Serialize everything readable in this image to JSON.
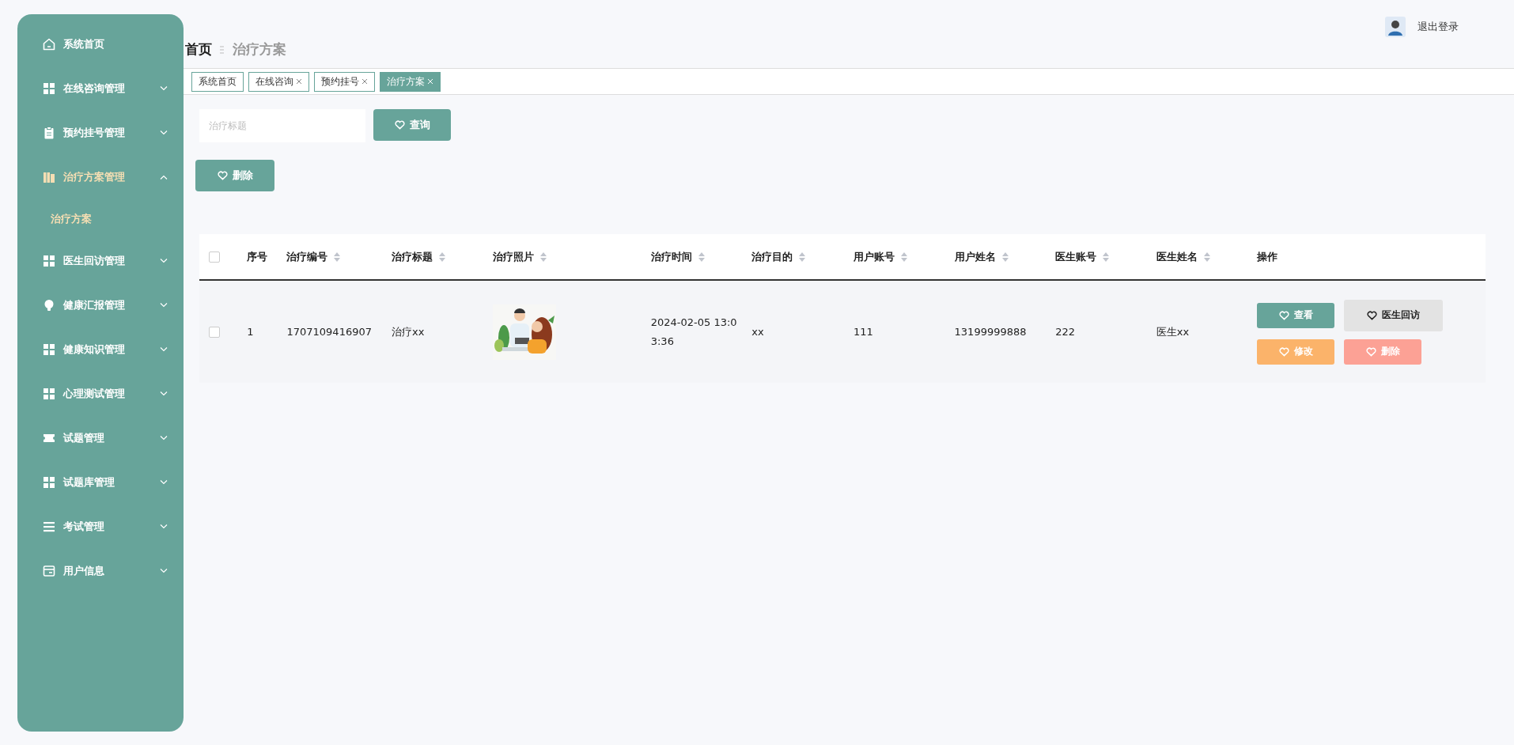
{
  "sidebar": {
    "items": [
      {
        "label": "系统首页",
        "kind": "home"
      },
      {
        "label": "在线咨询管理",
        "kind": "grid",
        "expandable": true,
        "expanded": false
      },
      {
        "label": "预约挂号管理",
        "kind": "clipboard",
        "expandable": true,
        "expanded": false
      },
      {
        "label": "治疗方案管理",
        "kind": "books",
        "expandable": true,
        "expanded": true,
        "children": [
          {
            "label": "治疗方案",
            "selected": true
          }
        ]
      },
      {
        "label": "医生回访管理",
        "kind": "grid",
        "expandable": true,
        "expanded": false
      },
      {
        "label": "健康汇报管理",
        "kind": "bulb",
        "expandable": true,
        "expanded": false
      },
      {
        "label": "健康知识管理",
        "kind": "grid",
        "expandable": true,
        "expanded": false
      },
      {
        "label": "心理测试管理",
        "kind": "grid",
        "expandable": true,
        "expanded": false
      },
      {
        "label": "试题管理",
        "kind": "ticket",
        "expandable": true,
        "expanded": false
      },
      {
        "label": "试题库管理",
        "kind": "grid",
        "expandable": true,
        "expanded": false
      },
      {
        "label": "考试管理",
        "kind": "list",
        "expandable": true,
        "expanded": false
      },
      {
        "label": "用户信息",
        "kind": "card",
        "expandable": true,
        "expanded": false
      }
    ]
  },
  "header": {
    "logout": "退出登录"
  },
  "breadcrumb": [
    "首页",
    "治疗方案"
  ],
  "tabs": [
    {
      "label": "系统首页",
      "closable": false,
      "selected": false
    },
    {
      "label": "在线咨询",
      "closable": true,
      "selected": false
    },
    {
      "label": "预约挂号",
      "closable": true,
      "selected": false
    },
    {
      "label": "治疗方案",
      "closable": true,
      "selected": true
    }
  ],
  "search": {
    "placeholder": "治疗标题",
    "button": "查询"
  },
  "toolbar": {
    "delete": "删除"
  },
  "table": {
    "header_checked": false,
    "columns": [
      {
        "label": "序号",
        "sortable": false
      },
      {
        "label": "治疗编号",
        "sortable": true
      },
      {
        "label": "治疗标题",
        "sortable": true
      },
      {
        "label": "治疗照片",
        "sortable": true
      },
      {
        "label": "治疗时间",
        "sortable": true
      },
      {
        "label": "治疗目的",
        "sortable": true
      },
      {
        "label": "用户账号",
        "sortable": true
      },
      {
        "label": "用户姓名",
        "sortable": true
      },
      {
        "label": "医生账号",
        "sortable": true
      },
      {
        "label": "医生姓名",
        "sortable": true
      },
      {
        "label": "操作",
        "sortable": false
      }
    ],
    "rows": [
      {
        "checked": false,
        "cells": [
          "1",
          "1707109416907",
          "治疗xx",
          {
            "kind": "picture"
          },
          "2024-02-05 13:03:36",
          "xx",
          "111",
          "13199999888",
          "222",
          "医生xx"
        ],
        "actions": [
          {
            "label": "查看",
            "kind": "view"
          },
          {
            "label": "医生回访",
            "kind": "revisit"
          },
          {
            "label": "修改",
            "kind": "edit"
          },
          {
            "label": "删除",
            "kind": "delete"
          }
        ]
      }
    ]
  }
}
